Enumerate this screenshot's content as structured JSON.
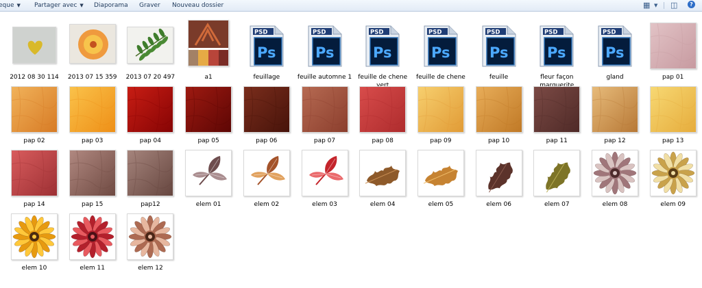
{
  "toolbar": {
    "items": [
      {
        "label": "eque",
        "dropdown": true
      },
      {
        "label": "Partager avec",
        "dropdown": true
      },
      {
        "label": "Diaporama",
        "dropdown": false
      },
      {
        "label": "Graver",
        "dropdown": false
      },
      {
        "label": "Nouveau dossier",
        "dropdown": false
      }
    ],
    "icons": [
      "change-view-icon",
      "view-dropdown-icon",
      "preview-pane-icon",
      "help-icon"
    ]
  },
  "psd_badge": "PSD",
  "ps_glyph": "Ps",
  "files": [
    {
      "name": "2012 08 30 114",
      "thumb": "photo-heart"
    },
    {
      "name": "2013 07 15 359",
      "thumb": "photo-flower"
    },
    {
      "name": "2013 07 20 497",
      "thumb": "photo-leaf"
    },
    {
      "name": "a1",
      "thumb": "palette"
    },
    {
      "name": "feuillage",
      "thumb": "psd"
    },
    {
      "name": "feuille automne 1",
      "thumb": "psd"
    },
    {
      "name": "feuille de chene vert",
      "thumb": "psd"
    },
    {
      "name": "feuille de chene",
      "thumb": "psd"
    },
    {
      "name": "feuille",
      "thumb": "psd"
    },
    {
      "name": "fleur façon marguerite",
      "thumb": "psd"
    },
    {
      "name": "gland",
      "thumb": "psd"
    },
    {
      "name": "pap 01",
      "thumb": "paper",
      "colors": [
        "#e2c3c6",
        "#c79aa0"
      ]
    },
    {
      "name": "pap 02",
      "thumb": "paper",
      "colors": [
        "#f1b25a",
        "#d77b25"
      ]
    },
    {
      "name": "pap 03",
      "thumb": "paper",
      "colors": [
        "#fac24a",
        "#ee8f17"
      ]
    },
    {
      "name": "pap 04",
      "thumb": "paper",
      "colors": [
        "#c81d14",
        "#860404"
      ]
    },
    {
      "name": "pap 05",
      "thumb": "paper",
      "colors": [
        "#9e1a11",
        "#5d0604"
      ]
    },
    {
      "name": "pap 06",
      "thumb": "paper",
      "colors": [
        "#7a2d1c",
        "#47130a"
      ]
    },
    {
      "name": "pap 07",
      "thumb": "paper",
      "colors": [
        "#b66a52",
        "#8b3e2d"
      ]
    },
    {
      "name": "pap 08",
      "thumb": "paper",
      "colors": [
        "#d84c4b",
        "#ae2c2d"
      ]
    },
    {
      "name": "pap 09",
      "thumb": "paper",
      "colors": [
        "#f7cf6e",
        "#e19b36"
      ]
    },
    {
      "name": "pap 10",
      "thumb": "paper",
      "colors": [
        "#e8ad59",
        "#c07926"
      ]
    },
    {
      "name": "pap 11",
      "thumb": "paper",
      "colors": [
        "#7b4a45",
        "#4f2a27"
      ]
    },
    {
      "name": "pap 12",
      "thumb": "paper",
      "colors": [
        "#e7bb7a",
        "#b77836"
      ]
    },
    {
      "name": "pap 13",
      "thumb": "paper",
      "colors": [
        "#f7d873",
        "#e6ac3c"
      ]
    },
    {
      "name": "pap 14",
      "thumb": "paper",
      "colors": [
        "#d85c5d",
        "#9d3034"
      ]
    },
    {
      "name": "pap 15",
      "thumb": "paper",
      "colors": [
        "#b08880",
        "#6f4a42"
      ]
    },
    {
      "name": "pap12",
      "thumb": "paper",
      "colors": [
        "#a5847c",
        "#66463f"
      ]
    },
    {
      "name": "elem 01",
      "thumb": "leaf3",
      "colors": [
        "#6e4d4e",
        "#aa8d8f"
      ]
    },
    {
      "name": "elem 02",
      "thumb": "leaf3",
      "colors": [
        "#a4532a",
        "#e1a15e"
      ]
    },
    {
      "name": "elem 03",
      "thumb": "leaf3",
      "colors": [
        "#c4242b",
        "#ea6a6c"
      ]
    },
    {
      "name": "elem 04",
      "thumb": "oak",
      "colors": [
        "#8e5a2a",
        "#c98f55"
      ]
    },
    {
      "name": "elem 05",
      "thumb": "oak",
      "colors": [
        "#c68332",
        "#efbc6a"
      ]
    },
    {
      "name": "elem 06",
      "thumb": "oak2",
      "colors": [
        "#5c332b",
        "#8a5a4d"
      ]
    },
    {
      "name": "elem 07",
      "thumb": "oak2",
      "colors": [
        "#7d7427",
        "#b8ad55"
      ]
    },
    {
      "name": "elem 08",
      "thumb": "flower",
      "colors": [
        "#d9c3c1",
        "#a0767a",
        "#4d2a2b"
      ]
    },
    {
      "name": "elem 09",
      "thumb": "flower",
      "colors": [
        "#f1dfa5",
        "#c9a24b",
        "#5a3d16"
      ]
    },
    {
      "name": "elem 10",
      "thumb": "flower",
      "colors": [
        "#ffc83b",
        "#e79a10",
        "#4c2a10"
      ]
    },
    {
      "name": "elem 11",
      "thumb": "flower",
      "colors": [
        "#e85a5f",
        "#b3202c",
        "#4c1016"
      ]
    },
    {
      "name": "elem 12",
      "thumb": "flower",
      "colors": [
        "#e7b79f",
        "#ad6a52",
        "#4a2616"
      ]
    }
  ]
}
